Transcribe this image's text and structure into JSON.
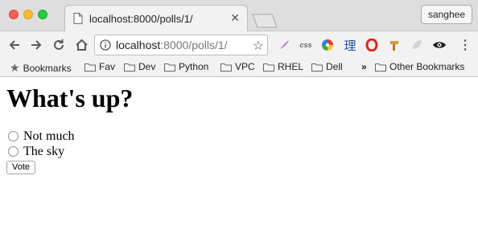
{
  "window": {
    "tab": {
      "title": "localhost:8000/polls/1/"
    },
    "profile_name": "sanghee"
  },
  "toolbar": {
    "url_host": "localhost",
    "url_rest": ":8000/polls/1/",
    "extensions": [
      "feather-icon",
      "css-icon",
      "colorwheel-icon",
      "kanji-icon",
      "opera-icon",
      "hammer-icon",
      "grayleaf-icon",
      "eye-icon"
    ],
    "css_label": "css",
    "kanji_label": "理"
  },
  "bookmarks": {
    "items": [
      {
        "label": "Bookmarks",
        "icon": "star-icon"
      },
      {
        "label": "Fav",
        "icon": "folder-icon"
      },
      {
        "label": "Dev",
        "icon": "folder-icon"
      },
      {
        "label": "Python",
        "icon": "folder-icon"
      },
      {
        "label": "VPC",
        "icon": "folder-icon"
      },
      {
        "label": "RHEL",
        "icon": "folder-icon"
      },
      {
        "label": "Dell",
        "icon": "folder-icon"
      }
    ],
    "overflow": "»",
    "other": "Other Bookmarks"
  },
  "page": {
    "heading": "What's up?",
    "choices": [
      "Not much",
      "The sky"
    ],
    "vote_label": "Vote"
  }
}
